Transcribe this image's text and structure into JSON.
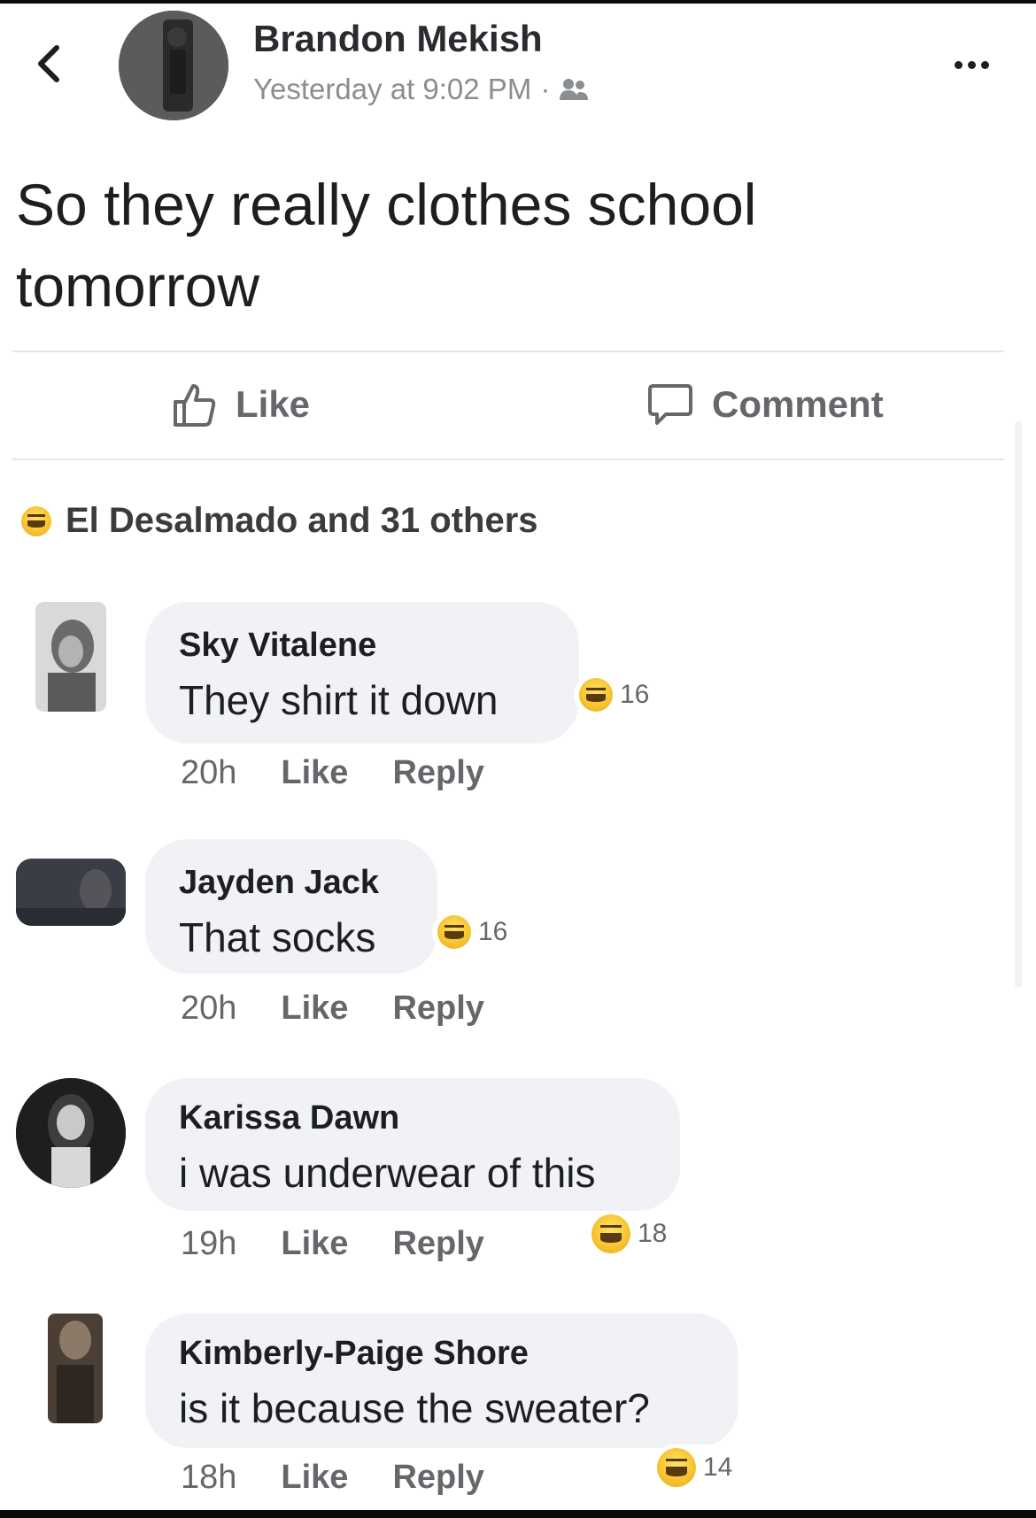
{
  "post": {
    "author": "Brandon Mekish",
    "timestamp": "Yesterday at 9:02 PM",
    "separator": "·",
    "audience_icon": "friends-icon",
    "text": "So they really clothes school tomorrow"
  },
  "actions": {
    "like_label": "Like",
    "comment_label": "Comment"
  },
  "reactions": {
    "summary": "El Desalmado and 31 others",
    "reaction_icon": "haha-icon"
  },
  "comments": [
    {
      "name": "Sky Vitalene",
      "text": "They shirt it down",
      "reactions": "16",
      "time": "20h",
      "like": "Like",
      "reply": "Reply"
    },
    {
      "name": "Jayden Jack",
      "text": "That socks",
      "reactions": "16",
      "time": "20h",
      "like": "Like",
      "reply": "Reply"
    },
    {
      "name": "Karissa Dawn",
      "text": "i was underwear of this",
      "reactions": "18",
      "time": "19h",
      "like": "Like",
      "reply": "Reply"
    },
    {
      "name": "Kimberly-Paige Shore",
      "text": "is it because the sweater?",
      "reactions": "14",
      "time": "18h",
      "like": "Like",
      "reply": "Reply"
    }
  ]
}
